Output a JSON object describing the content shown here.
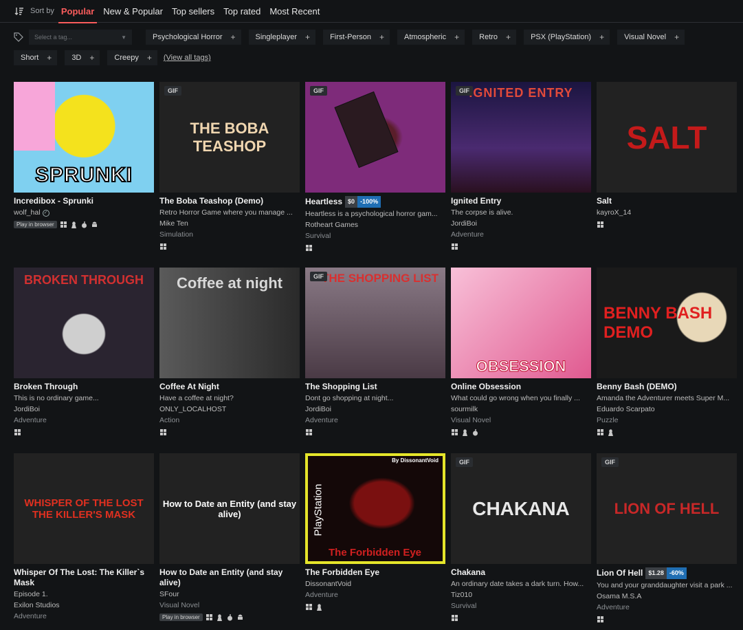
{
  "sort": {
    "label": "Sort by",
    "tabs": [
      {
        "label": "Popular",
        "active": true
      },
      {
        "label": "New & Popular",
        "active": false
      },
      {
        "label": "Top sellers",
        "active": false
      },
      {
        "label": "Top rated",
        "active": false
      },
      {
        "label": "Most Recent",
        "active": false
      }
    ]
  },
  "tags": {
    "placeholder": "Select a tag...",
    "items": [
      "Psychological Horror",
      "Singleplayer",
      "First-Person",
      "Atmospheric",
      "Retro",
      "PSX (PlayStation)",
      "Visual Novel",
      "Short",
      "3D",
      "Creepy"
    ],
    "view_all": "(View all tags)"
  },
  "games": [
    {
      "title": "Incredibox - Sprunki",
      "desc": "",
      "author": "wolf_hal",
      "verified": true,
      "genre": "",
      "gif": false,
      "price": "",
      "discount": "",
      "play_in_browser": true,
      "platforms": [
        "windows",
        "linux",
        "mac",
        "android"
      ],
      "art_text": "SPRUNKI",
      "art_bg": "#7fd0f0"
    },
    {
      "title": "The Boba Teashop (Demo)",
      "desc": "Retro Horror Game where you manage ...",
      "author": "Mike Ten",
      "verified": false,
      "genre": "Simulation",
      "gif": true,
      "price": "",
      "discount": "",
      "play_in_browser": false,
      "platforms": [
        "windows"
      ],
      "art_text": "THE BOBA TEASHOP",
      "art_bg": "#3c3a2e"
    },
    {
      "title": "Heartless",
      "desc": "Heartless is a psychological horror gam...",
      "author": "Rotheart Games",
      "verified": false,
      "genre": "Survival",
      "gif": true,
      "price": "$0",
      "discount": "-100%",
      "play_in_browser": false,
      "platforms": [
        "windows"
      ],
      "art_text": "",
      "art_bg": "#7e2b7a"
    },
    {
      "title": "Ignited Entry",
      "desc": "The corpse is alive.",
      "author": "JordiBoi",
      "verified": false,
      "genre": "Adventure",
      "gif": true,
      "price": "",
      "discount": "",
      "play_in_browser": false,
      "platforms": [
        "windows"
      ],
      "art_text": "IGNITED ENTRY",
      "art_bg": "#1b1540"
    },
    {
      "title": "Salt",
      "desc": "",
      "author": "kayroX_14",
      "verified": false,
      "genre": "",
      "gif": false,
      "price": "",
      "discount": "",
      "play_in_browser": false,
      "platforms": [
        "windows"
      ],
      "art_text": "SALT",
      "art_bg": "#d8d6d2"
    },
    {
      "title": "Broken Through",
      "desc": "This is no ordinary game...",
      "author": "JordiBoi",
      "verified": false,
      "genre": "Adventure",
      "gif": false,
      "price": "",
      "discount": "",
      "play_in_browser": false,
      "platforms": [
        "windows"
      ],
      "art_text": "BROKEN THROUGH",
      "art_bg": "#2a2430"
    },
    {
      "title": "Coffee At Night",
      "desc": "Have a coffee at night?",
      "author": "ONLY_LOCALHOST",
      "verified": false,
      "genre": "Action",
      "gif": false,
      "price": "",
      "discount": "",
      "play_in_browser": false,
      "platforms": [
        "windows"
      ],
      "art_text": "Coffee at night",
      "art_bg": "#3a3a3a"
    },
    {
      "title": "The Shopping List",
      "desc": "Dont go shopping at night...",
      "author": "JordiBoi",
      "verified": false,
      "genre": "Adventure",
      "gif": true,
      "price": "",
      "discount": "",
      "play_in_browser": false,
      "platforms": [
        "windows"
      ],
      "art_text": "THE SHOPPING LIST",
      "art_bg": "#4a3a45"
    },
    {
      "title": "Online Obsession",
      "desc": "What could go wrong when you finally ...",
      "author": "sourmilk",
      "verified": false,
      "genre": "Visual Novel",
      "gif": false,
      "price": "",
      "discount": "",
      "play_in_browser": false,
      "platforms": [
        "windows",
        "linux",
        "mac"
      ],
      "art_text": "OBSESSION",
      "art_bg": "#f0a8c8"
    },
    {
      "title": "Benny Bash (DEMO)",
      "desc": "Amanda the Adventurer meets Super M...",
      "author": "Eduardo Scarpato",
      "verified": false,
      "genre": "Puzzle",
      "gif": false,
      "price": "",
      "discount": "",
      "play_in_browser": false,
      "platforms": [
        "windows",
        "linux"
      ],
      "art_text": "BENNY BASH DEMO",
      "art_bg": "#1a1a1a"
    },
    {
      "title": "Whisper Of The Lost: The Killer`s Mask",
      "desc": "Episode 1.",
      "author": "Exilon Studios",
      "verified": false,
      "genre": "Adventure",
      "gif": false,
      "price": "",
      "discount": "",
      "play_in_browser": false,
      "platforms": [],
      "art_text": "WHISPER OF THE LOST THE KILLER'S MASK",
      "art_bg": "#3a3418"
    },
    {
      "title": "How to Date an Entity (and stay alive)",
      "desc": "",
      "author": "SFour",
      "verified": false,
      "genre": "Visual Novel",
      "gif": false,
      "price": "",
      "discount": "",
      "play_in_browser": true,
      "platforms": [
        "windows",
        "linux",
        "mac",
        "android"
      ],
      "art_text": "How to Date an Entity (and stay alive)",
      "art_bg": "#1f4a48"
    },
    {
      "title": "The Forbidden Eye",
      "desc": "",
      "author": "DissonantVoid",
      "verified": false,
      "genre": "Adventure",
      "gif": false,
      "price": "",
      "discount": "",
      "play_in_browser": false,
      "platforms": [
        "windows",
        "linux"
      ],
      "art_text": "The Forbidden Eye",
      "art_sub": "By DissonantVoid",
      "art_side": "PlayStation",
      "art_bg": "#140808",
      "highlight": true
    },
    {
      "title": "Chakana",
      "desc": "An ordinary date takes a dark turn. How...",
      "author": "Tiz010",
      "verified": false,
      "genre": "Survival",
      "gif": true,
      "price": "",
      "discount": "",
      "play_in_browser": false,
      "platforms": [
        "windows"
      ],
      "art_text": "CHAKANA",
      "art_bg": "#2a2a2a"
    },
    {
      "title": "Lion Of Hell",
      "desc": "You and your granddaughter visit a park ...",
      "author": "Osama M.S.A",
      "verified": false,
      "genre": "Adventure",
      "gif": true,
      "price": "$1.28",
      "discount": "-60%",
      "play_in_browser": false,
      "platforms": [
        "windows"
      ],
      "art_text": "LION OF HELL",
      "art_bg": "#4a3a2a"
    }
  ],
  "labels": {
    "gif": "GIF",
    "play_in_browser": "Play in browser"
  },
  "colors": {
    "accent": "#fa5c5c",
    "highlight": "#e5e52a",
    "discount_bg": "#1f6eb3"
  }
}
